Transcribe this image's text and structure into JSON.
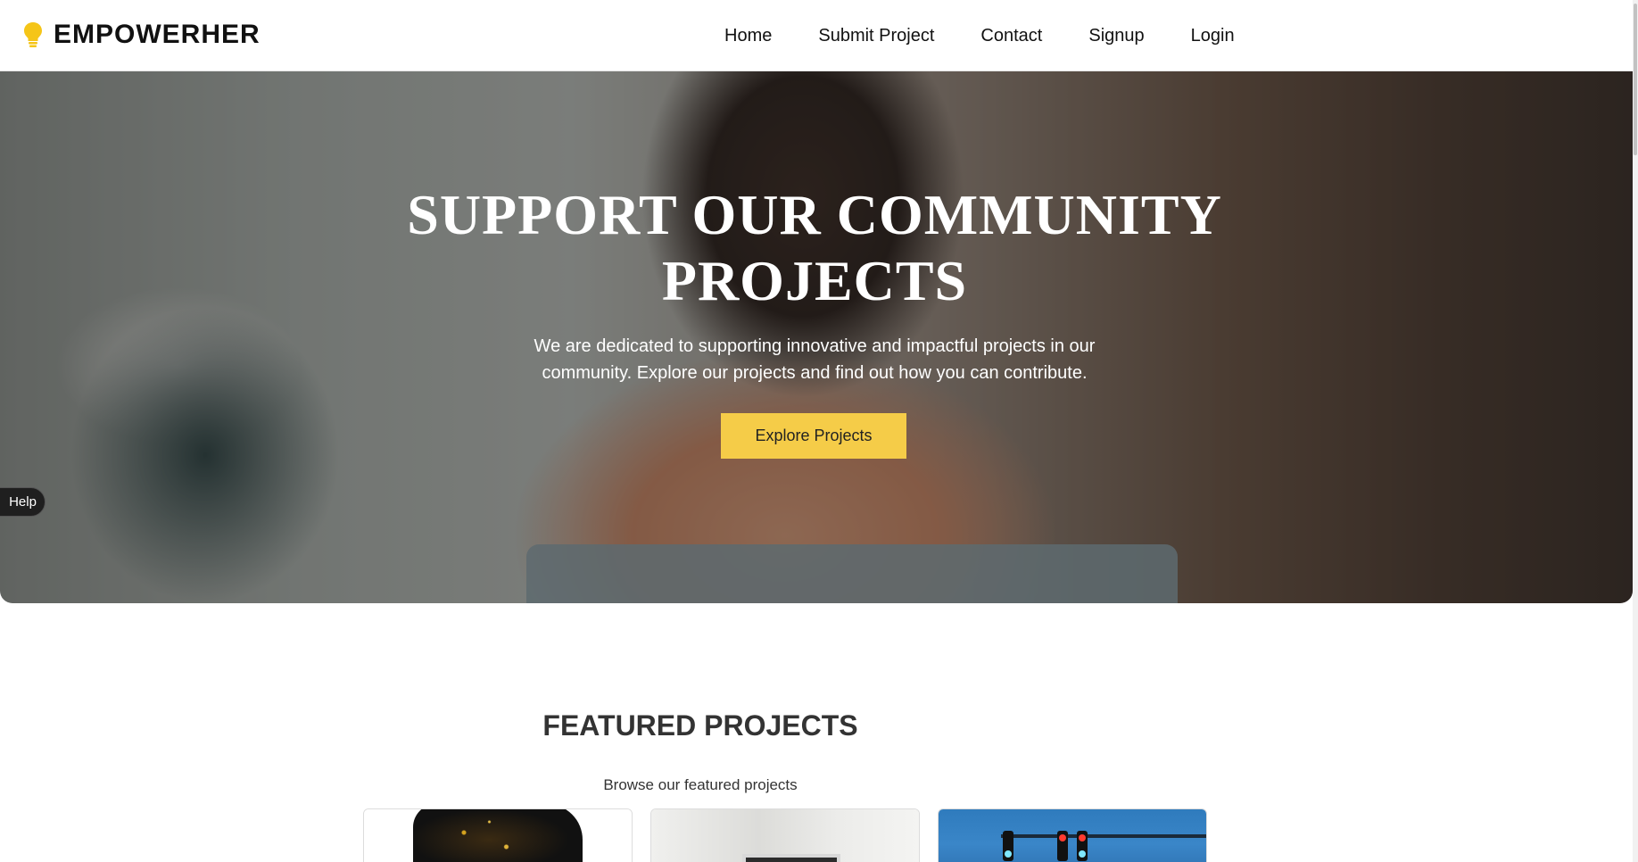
{
  "brand": {
    "name": "EMPOWERHER",
    "icon": "lightbulb-icon",
    "icon_color": "#f5c518"
  },
  "nav": {
    "items": [
      {
        "label": "Home"
      },
      {
        "label": "Submit Project"
      },
      {
        "label": "Contact"
      },
      {
        "label": "Signup"
      },
      {
        "label": "Login"
      }
    ]
  },
  "hero": {
    "title": "SUPPORT OUR COMMUNITY PROJECTS",
    "subtitle": "We are dedicated to supporting innovative and impactful projects in our community. Explore our projects and find out how you can contribute.",
    "button_label": "Explore Projects",
    "button_color": "#f5cc48"
  },
  "help": {
    "label": "Help"
  },
  "featured": {
    "title": "FEATURED PROJECTS",
    "subtitle": "Browse our featured projects",
    "cards": [
      {
        "image": "smartwatch-image"
      },
      {
        "image": "desk-monitor-image"
      },
      {
        "image": "traffic-light-image"
      }
    ]
  }
}
